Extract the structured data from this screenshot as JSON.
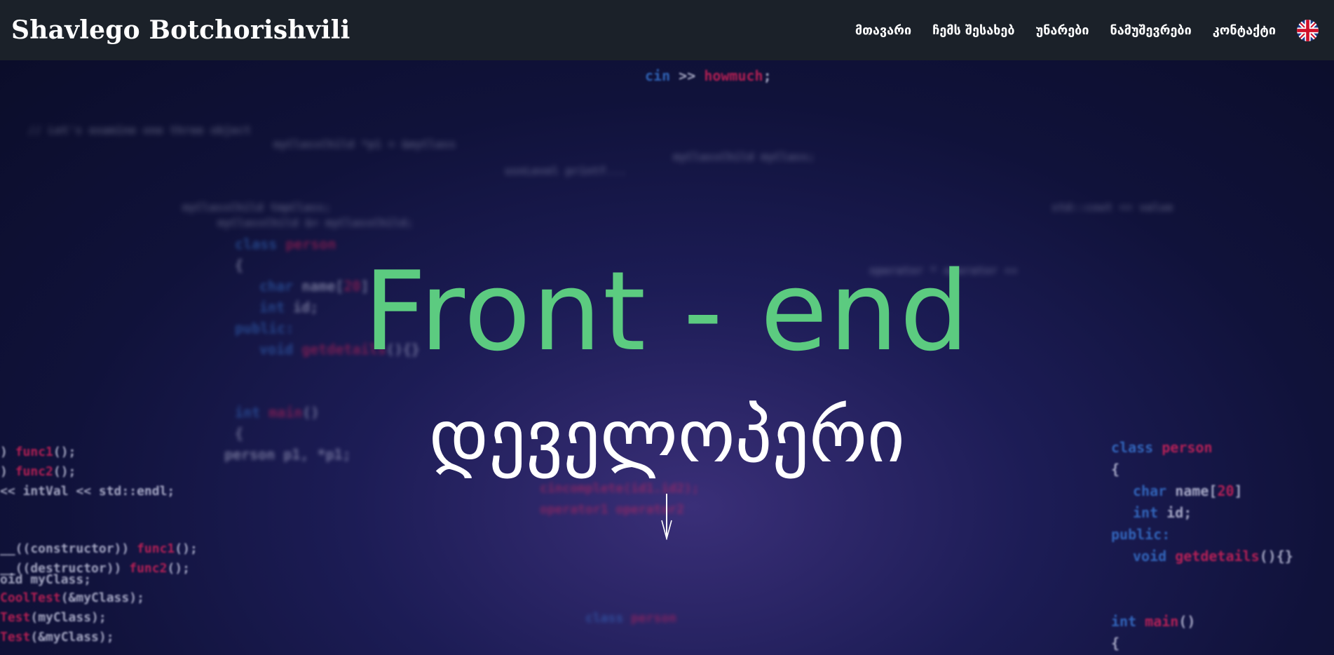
{
  "navbar": {
    "brand": "Shavlego Botchorishvili",
    "links": [
      "მთავარი",
      "ჩემს შესახებ",
      "უნარები",
      "ნამუშევრები",
      "კონტაქტი"
    ],
    "language_icon": "uk-flag-icon"
  },
  "hero": {
    "title": "Front - end",
    "subtitle": "დეველოპერი",
    "scroll_icon": "arrow-down-icon"
  },
  "background_code": {
    "top": "cin >> howmuch;",
    "right_block": [
      "class person",
      "{",
      "char name[20]",
      "int id;",
      "public:",
      "void getdetails(){}",
      "int main()",
      "{"
    ],
    "left_block": [
      "func1();",
      "func2();",
      "<< intVal << std::endl;",
      "__((constructor)) func1();",
      "__((destructor)) func2();",
      "oid myClass;",
      "CoolTest(&myClass);",
      "Test(myClass);",
      "Test(&myClass);"
    ],
    "center_block": [
      "class person",
      "{",
      "char name[20]",
      "int id;",
      "public:",
      "void getdetails(){}",
      "int main()",
      "person p1;"
    ]
  },
  "colors": {
    "navbar_bg": "#1b2129",
    "title_green": "#5ccb80",
    "keyword_blue": "#3b7fe0",
    "function_pink": "#e8245c"
  }
}
